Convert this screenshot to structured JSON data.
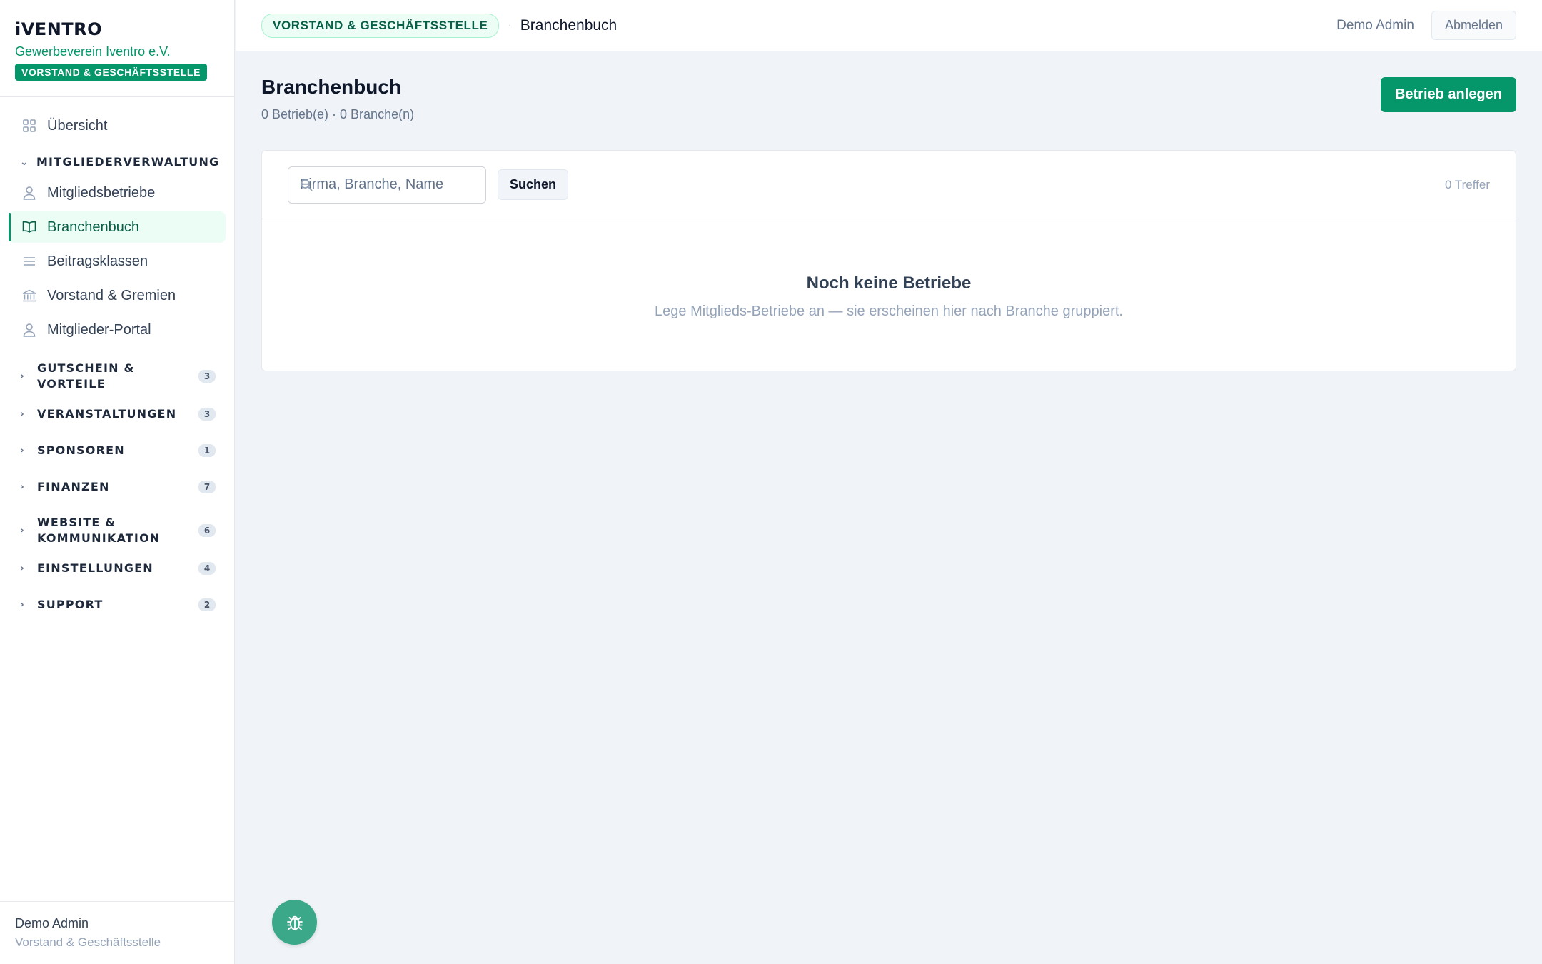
{
  "brand": {
    "logo": "iVENTRO",
    "org": "Gewerbeverein Iventro e.V.",
    "role": "VORSTAND & GESCHÄFTSSTELLE"
  },
  "sidebar": {
    "overview": "Übersicht",
    "group_mitglieder": "MITGLIEDERVERWALTUNG",
    "items": [
      {
        "label": "Mitgliedsbetriebe",
        "icon": "user-icon"
      },
      {
        "label": "Branchenbuch",
        "icon": "book-icon",
        "active": true
      },
      {
        "label": "Beitragsklassen",
        "icon": "list-icon"
      },
      {
        "label": "Vorstand & Gremien",
        "icon": "bank-icon"
      },
      {
        "label": "Mitglieder-Portal",
        "icon": "user-icon"
      }
    ],
    "sections": [
      {
        "line1": "GUTSCHEIN &",
        "line2": "VORTEILE",
        "count": "3"
      },
      {
        "line1": "VERANSTALTUNGEN",
        "line2": "",
        "count": "3"
      },
      {
        "line1": "SPONSOREN",
        "line2": "",
        "count": "1"
      },
      {
        "line1": "FINANZEN",
        "line2": "",
        "count": "7"
      },
      {
        "line1": "WEBSITE &",
        "line2": "KOMMUNIKATION",
        "count": "6"
      },
      {
        "line1": "EINSTELLUNGEN",
        "line2": "",
        "count": "4"
      },
      {
        "line1": "SUPPORT",
        "line2": "",
        "count": "2"
      }
    ],
    "footer_user": "Demo Admin",
    "footer_role": "Vorstand & Geschäftsstelle"
  },
  "topbar": {
    "chip": "VORSTAND & GESCHÄFTSSTELLE",
    "separator": "·",
    "crumb": "Branchenbuch",
    "user": "Demo Admin",
    "logout": "Abmelden"
  },
  "page": {
    "title": "Branchenbuch",
    "subtitle": "0 Betrieb(e) · 0 Branche(n)",
    "primary_button": "Betrieb anlegen"
  },
  "search": {
    "placeholder": "Firma, Branche, Name",
    "button": "Suchen",
    "hits": "0 Treffer"
  },
  "empty": {
    "title": "Noch keine Betriebe",
    "desc": "Lege Mitglieds-Betriebe an — sie erscheinen hier nach Branche gruppiert."
  },
  "colors": {
    "accent": "#059669",
    "accent_light": "#ecfdf5",
    "fab": "#3aa889"
  }
}
